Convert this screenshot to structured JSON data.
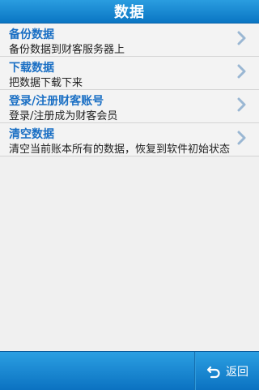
{
  "header": {
    "title": "数据"
  },
  "items": [
    {
      "title": "备份数据",
      "subtitle": "备份数据到财客服务器上",
      "icon": "chevron-right-icon"
    },
    {
      "title": "下载数据",
      "subtitle": "把数据下载下来",
      "icon": "chevron-right-icon"
    },
    {
      "title": "登录/注册财客账号",
      "subtitle": "登录/注册成为财客会员",
      "icon": "chevron-right-icon"
    },
    {
      "title": "清空数据",
      "subtitle": "清空当前账本所有的数据，恢复到软件初始状态",
      "icon": "chevron-right-icon"
    }
  ],
  "footer": {
    "back_label": "返回",
    "back_icon": "undo-arrow-icon"
  },
  "colors": {
    "accent": "#1a7fd0",
    "item_title": "#1a6fc4",
    "chevron": "#9ab7d3"
  }
}
